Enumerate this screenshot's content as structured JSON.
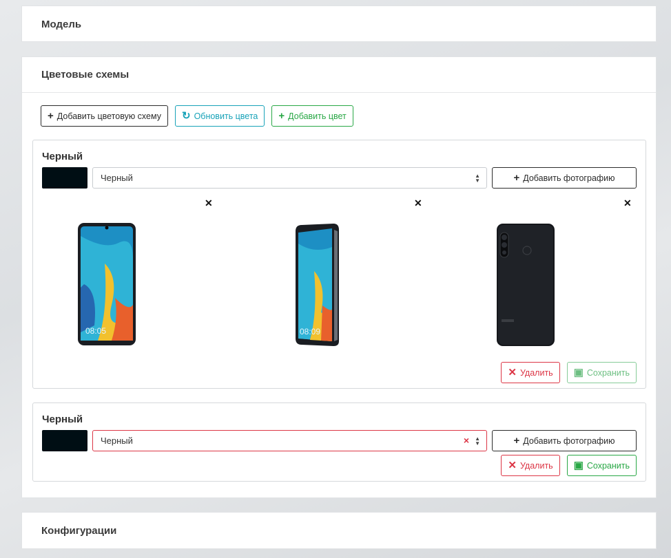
{
  "cards": {
    "model_title": "Модель",
    "schemes_title": "Цветовые схемы",
    "config_title": "Конфигурации"
  },
  "toolbar": {
    "add_scheme": "Добавить цветовую схему",
    "refresh_colors": "Обновить цвета",
    "add_color": "Добавить цвет"
  },
  "schemes": [
    {
      "title": "Черный",
      "swatch_color": "#000e14",
      "selected_color": "Черный",
      "add_photo": "Добавить фотографию",
      "photos": [
        "phone-front-icon",
        "phone-angle-icon",
        "phone-back-icon"
      ],
      "delete": "Удалить",
      "save": "Сохранить"
    },
    {
      "title": "Черный",
      "swatch_color": "#000e14",
      "selected_color": "Черный",
      "add_photo": "Добавить фотографию",
      "delete": "Удалить",
      "save": "Сохранить"
    }
  ],
  "icons": {
    "plus": "+",
    "refresh": "↻",
    "close": "✕",
    "remove": "×",
    "save": "💾"
  },
  "colors": {
    "info": "#17a2b8",
    "success": "#28a745",
    "danger": "#dc3545"
  }
}
